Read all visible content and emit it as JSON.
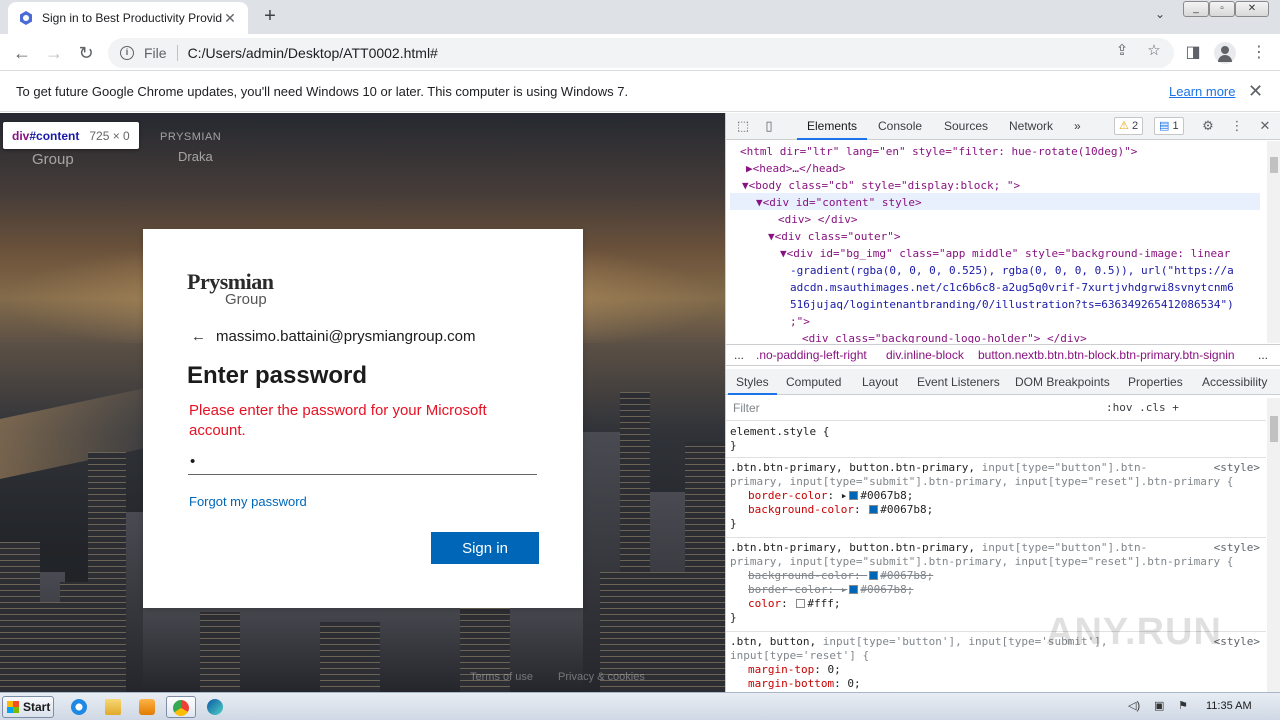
{
  "browser": {
    "tab_title": "Sign in to Best Productivity Provider",
    "url_scheme": "File",
    "url": "C:/Users/admin/Desktop/ATT0002.html#",
    "infobar_message": "To get future Google Chrome updates, you'll need Windows 10 or later. This computer is using Windows 7.",
    "infobar_link": "Learn more"
  },
  "page": {
    "inspect_tooltip": {
      "tag": "div",
      "id": "#content",
      "dims": "725 × 0"
    },
    "bg_logo_top": "PRYSMIAN",
    "bg_logo_bottom": "Draka",
    "bg_logo_group": "Group",
    "brand_line1": "Prysmian",
    "brand_line2": "Group",
    "identity": "massimo.battaini@prysmiangroup.com",
    "heading": "Enter password",
    "error": "Please enter the password for your Microsoft account.",
    "password_value": "•",
    "forgot_link": "Forgot my password",
    "signin_button": "Sign in",
    "footer_terms": "Terms of use",
    "footer_privacy": "Privacy & cookies"
  },
  "devtools": {
    "tabs": [
      "Elements",
      "Console",
      "Sources",
      "Network"
    ],
    "more": "»",
    "warnings": "2",
    "messages": "1",
    "dom_lines": [
      "<html dir=\"ltr\" lang=\"en\" style=\"filter: hue-rotate(10deg)\">",
      "▶<head>…</head>",
      "▼<body class=\"cb\" style=\"display:block; \">",
      "▼<div id=\"content\" style>",
      "<div> </div>",
      "▼<div class=\"outer\">",
      "▼<div id=\"bg_img\" class=\"app middle\" style=\"background-image: linear",
      "-gradient(rgba(0, 0, 0, 0.525), rgba(0, 0, 0, 0.5)), url(\"https://a",
      "adcdn.msauthimages.net/c1c6b6c8-a2ug5q0vrif-7xurtjvhdgrwi8svnytcnm6",
      "516jujaq/logintenantbranding/0/illustration?ts=636349265412086534\")",
      ";\">",
      "<div class=\"background-logo-holder\"> </div>"
    ],
    "breadcrumbs": [
      "...",
      ".no-padding-left-right",
      "div.inline-block",
      "button.nextb.btn.btn-block.btn-primary.btn-signin",
      "..."
    ],
    "style_tabs": [
      "Styles",
      "Computed",
      "Layout",
      "Event Listeners",
      "DOM Breakpoints",
      "Properties",
      "Accessibility"
    ],
    "filter_placeholder": "Filter",
    "filter_tools": ":hov  .cls  +",
    "rules": {
      "element_style": "element.style {",
      "close": "}",
      "source": "<style>",
      "r1_selector": ".btn.btn-primary, button.btn-primary,",
      "r1_selector_dim": "input[type=\"button\"].btn-",
      "r1_selector2": "primary, input[type=\"submit\"].btn-primary, input[type=\"reset\"].btn-primary {",
      "r1_p1_name": "border-color",
      "r1_p1_value": "#0067b8;",
      "r1_p2_name": "background-color",
      "r1_p2_value": "#0067b8;",
      "r2_selector": ".btn.btn-primary, button.btn-primary,",
      "r2_selector_dim": "input[type=\"button\"].btn-",
      "r2_selector2": "primary, input[type=\"submit\"].btn-primary, input[type=\"reset\"].btn-primary {",
      "r2_p1_name": "background-color",
      "r2_p1_value": "#0067b8;",
      "r2_p2_name": "border-color",
      "r2_p2_value": "#0067b8;",
      "r2_p3_name": "color",
      "r2_p3_value": "#fff;",
      "r3_selector": ".btn, button,",
      "r3_selector_dim": "input[type='button'], input[type='submit'],",
      "r3_selector2": "input[type='reset'] {",
      "r3_p1_name": "margin-top",
      "r3_p1_value": "0;",
      "r3_p2_name": "margin-bottom",
      "r3_p2_value": "0;"
    },
    "watermark": "ANY.RUN"
  },
  "taskbar": {
    "start_label": "Start",
    "clock": "11:35 AM"
  },
  "colors": {
    "ms_blue": "#0067b8",
    "error_red": "#e81123",
    "accent": "#1a73e8"
  }
}
